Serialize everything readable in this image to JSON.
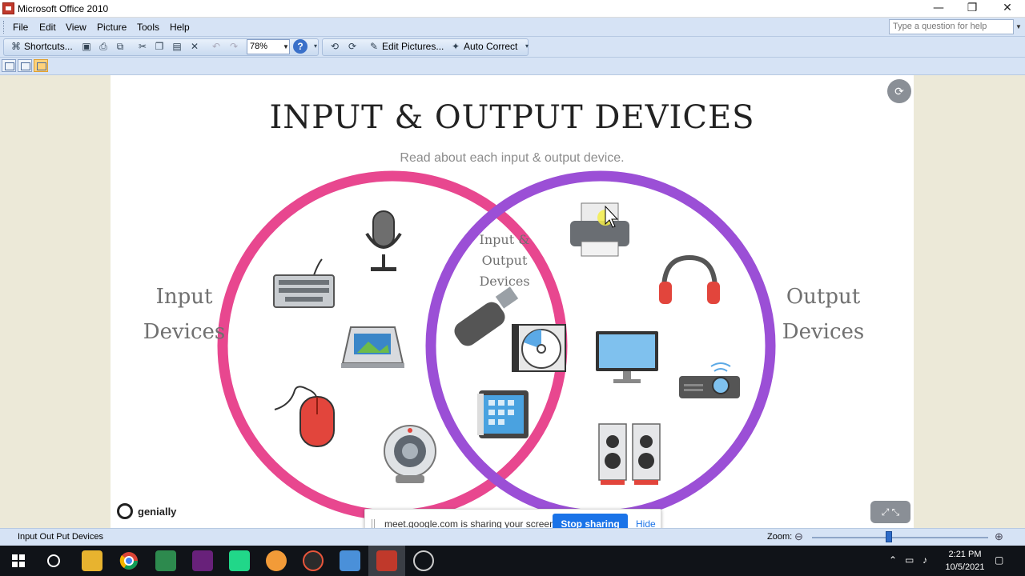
{
  "window": {
    "title": "Microsoft Office 2010",
    "controls": {
      "minimize": "—",
      "restore": "❐",
      "close": "✕"
    }
  },
  "menubar": {
    "items": [
      "File",
      "Edit",
      "View",
      "Picture",
      "Tools",
      "Help"
    ],
    "help_placeholder": "Type a question for help"
  },
  "toolbar": {
    "shortcuts_label": "Shortcuts...",
    "zoom_value": "78%",
    "edit_pictures_label": "Edit Pictures...",
    "auto_correct_label": "Auto Correct"
  },
  "slide": {
    "title": "INPUT & OUTPUT DEVICES",
    "subtitle": "Read about each input & output device.",
    "input_label_1": "Input",
    "input_label_2": "Devices",
    "both_label_1": "Input &",
    "both_label_2": "Output Devices",
    "output_label_1": "Output",
    "output_label_2": "Devices",
    "brand": "genially",
    "colors": {
      "input_circle": "#e8478f",
      "output_circle": "#9b4fd6",
      "accent": "#1a73e8"
    },
    "input_devices": [
      "keyboard-icon",
      "microphone-icon",
      "scanner-icon",
      "mouse-icon",
      "webcam-icon"
    ],
    "both_devices": [
      "usb-drive-icon",
      "cd-icon",
      "tablet-icon"
    ],
    "output_devices": [
      "printer-icon",
      "headphones-icon",
      "monitor-icon",
      "projector-icon",
      "speakers-icon"
    ]
  },
  "share_banner": {
    "text": "meet.google.com is sharing your screen.",
    "stop_label": "Stop sharing",
    "hide_label": "Hide"
  },
  "statusbar": {
    "filename": "Input Out Put Devices",
    "zoom_label": "Zoom:"
  },
  "taskbar": {
    "time": "2:21 PM",
    "date": "10/5/2021"
  }
}
